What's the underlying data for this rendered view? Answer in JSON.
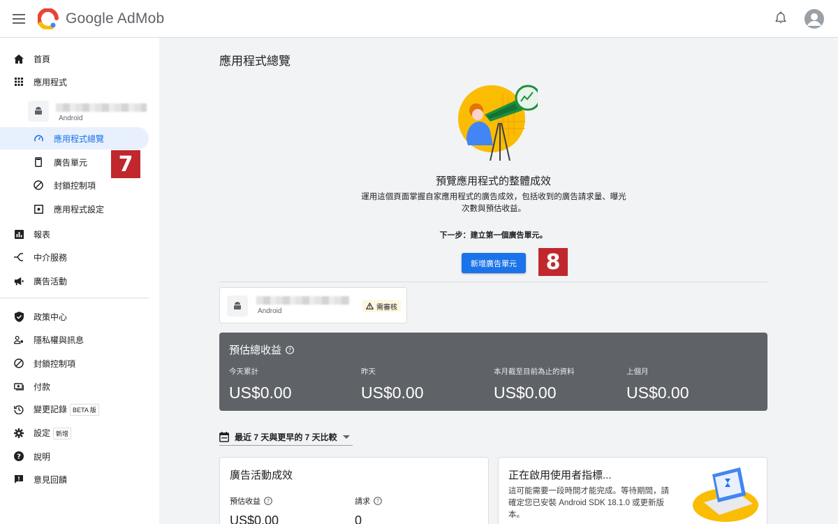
{
  "header": {
    "app_name": "Google AdMob",
    "menu_icon": "hamburger-menu-icon",
    "notification_icon": "bell-icon",
    "avatar_icon": "account-avatar-icon"
  },
  "sidebar": {
    "home": "首頁",
    "apps": "應用程式",
    "selected_app_platform": "Android",
    "app_overview": "應用程式總覽",
    "ad_units": "廣告單元",
    "blocking_controls_app": "封鎖控制項",
    "app_settings": "應用程式設定",
    "reports": "報表",
    "mediation": "中介服務",
    "campaigns": "廣告活動",
    "policy_center": "政策中心",
    "privacy_messaging": "隱私權與訊息",
    "blocking_controls": "封鎖控制項",
    "payments": "付款",
    "change_history": "變更記錄",
    "change_history_tag": "BETA 版",
    "settings": "設定",
    "settings_tag": "新增",
    "help": "說明",
    "feedback": "意見回饋"
  },
  "annotations": {
    "step7": "7",
    "step8": "8"
  },
  "main": {
    "page_title": "應用程式總覽",
    "hero_title": "預覽應用程式的整體成效",
    "hero_desc": "運用這個頁面掌握自家應用程式的廣告成效，包括收到的廣告請求量、曝光次數與預估收益。",
    "next_step": "下一步：建立第一個廣告單元。",
    "add_ad_unit_button": "新增廣告單元",
    "app_card_platform": "Android",
    "review_status": "需審核",
    "earnings": {
      "title": "預估總收益",
      "metrics": [
        {
          "label": "今天累計",
          "value": "US$0.00"
        },
        {
          "label": "昨天",
          "value": "US$0.00"
        },
        {
          "label": "本月截至目前為止的資料",
          "value": "US$0.00"
        },
        {
          "label": "上個月",
          "value": "US$0.00"
        }
      ]
    },
    "date_filter": "最近 7 天與更早的 7 天比較",
    "campaign_card": {
      "title": "廣告活動成效",
      "kpi1_label": "預估收益",
      "kpi1_value": "US$0.00",
      "kpi2_label": "請求",
      "kpi2_value": "0"
    },
    "user_metrics_card": {
      "title": "正在啟用使用者指標...",
      "desc": "這可能需要一段時間才能完成。等待期間，請確定您已安裝 Android SDK 18.1.0 或更新版本。"
    }
  }
}
